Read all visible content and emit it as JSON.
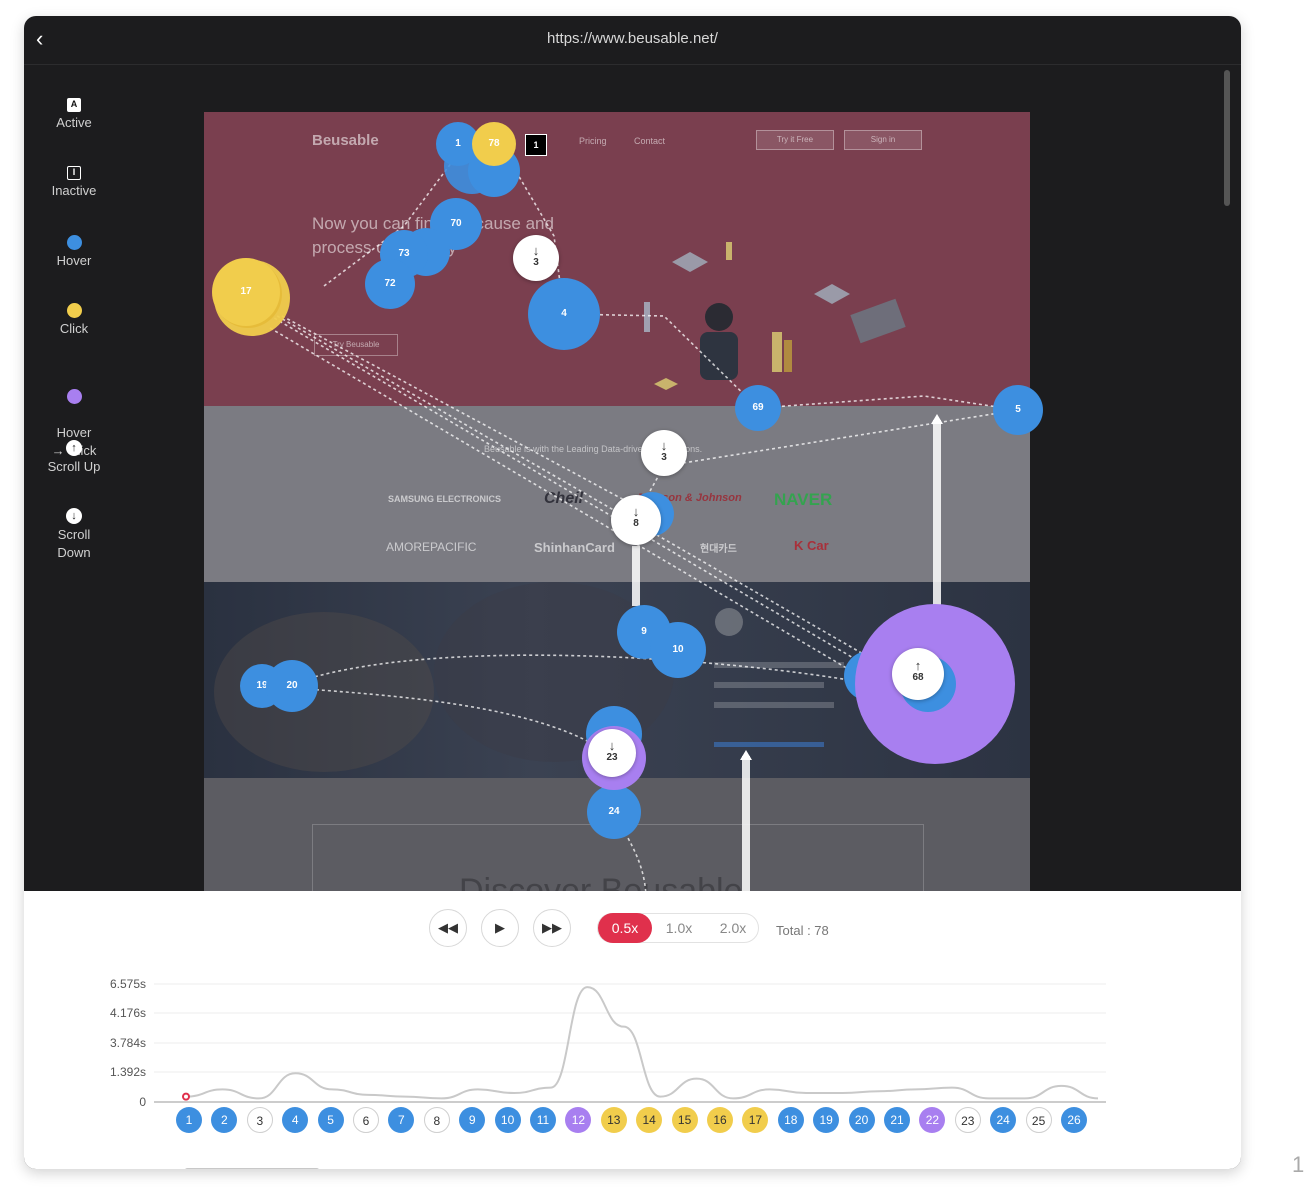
{
  "window": {
    "url": "https://www.beusable.net/"
  },
  "legend": [
    {
      "label": "Active",
      "icon": "active-square-icon"
    },
    {
      "label": "Inactive",
      "icon": "inactive-square-icon"
    },
    {
      "label": "Hover",
      "icon": "hover-dot-icon",
      "color": "#3d8fe0"
    },
    {
      "label": "Click",
      "icon": "click-dot-icon",
      "color": "#f1cd4c"
    },
    {
      "label": "Hover\n→ Click",
      "icon": "hover-click-dot-icon",
      "color": "#a87ff0"
    },
    {
      "label": "Scroll Up",
      "icon": "scroll-up-icon"
    },
    {
      "label": "Scroll Down",
      "icon": "scroll-down-icon"
    }
  ],
  "site": {
    "brand": "Beusable",
    "nav": [
      "Pricing",
      "Contact"
    ],
    "buttons": [
      "Try it Free",
      "Sign in"
    ],
    "headline": "Now you can find the cause and process of usability",
    "cta": "Try Beusable",
    "partners_heading": "Beusable is with the Leading Data-driven corporations.",
    "partner_logos": [
      "SAMSUNG ELECTRONICS",
      "Cheil",
      "Johnson & Johnson",
      "NAVER",
      "AMOREPACIFIC",
      "ShinhanCard",
      "현대카드",
      "K Car"
    ],
    "bottom_heading": "Discover Beusable"
  },
  "markers": {
    "hover": [
      "1",
      "70",
      "73",
      "72",
      "4",
      "69",
      "5",
      "9",
      "10",
      "19",
      "20",
      "24"
    ],
    "click": [
      "78",
      "17"
    ],
    "hover_click": [
      "68"
    ],
    "scroll": [
      {
        "label": "3",
        "dir": "down"
      },
      {
        "label": "3",
        "dir": "down"
      },
      {
        "label": "8",
        "dir": "down"
      },
      {
        "label": "68",
        "dir": "up"
      },
      {
        "label": "23",
        "dir": "down"
      }
    ],
    "active": "1"
  },
  "controls": {
    "rewind": "rewind-icon",
    "play": "play-icon",
    "forward": "fast-forward-icon",
    "speeds": [
      "0.5x",
      "1.0x",
      "2.0x"
    ],
    "selected_speed": "0.5x",
    "total": "Total : 78"
  },
  "chart_data": {
    "type": "line",
    "ylabels": [
      "6.575s",
      "4.176s",
      "3.784s",
      "1.392s",
      "0"
    ],
    "x": [
      "1",
      "2",
      "3",
      "4",
      "5",
      "6",
      "7",
      "8",
      "9",
      "10",
      "11",
      "12",
      "13",
      "14",
      "15",
      "16",
      "17",
      "18",
      "19",
      "20",
      "21",
      "22",
      "23",
      "24",
      "25",
      "26"
    ],
    "y": [
      0.3,
      0.7,
      0.2,
      1.6,
      0.7,
      0.4,
      0.3,
      0.2,
      0.7,
      0.5,
      0.8,
      6.4,
      4.2,
      0.3,
      1.3,
      0.2,
      0.7,
      0.5,
      0.5,
      0.6,
      0.7,
      0.8,
      0.2,
      0.2,
      0.9,
      0.2
    ]
  },
  "sequence": [
    {
      "n": "1",
      "t": "hover"
    },
    {
      "n": "2",
      "t": "hover"
    },
    {
      "n": "3",
      "t": "scroll"
    },
    {
      "n": "4",
      "t": "hover"
    },
    {
      "n": "5",
      "t": "hover"
    },
    {
      "n": "6",
      "t": "scroll"
    },
    {
      "n": "7",
      "t": "hover"
    },
    {
      "n": "8",
      "t": "scroll"
    },
    {
      "n": "9",
      "t": "hover"
    },
    {
      "n": "10",
      "t": "hover"
    },
    {
      "n": "11",
      "t": "hover"
    },
    {
      "n": "12",
      "t": "hoverclick"
    },
    {
      "n": "13",
      "t": "click"
    },
    {
      "n": "14",
      "t": "click"
    },
    {
      "n": "15",
      "t": "click"
    },
    {
      "n": "16",
      "t": "click"
    },
    {
      "n": "17",
      "t": "click"
    },
    {
      "n": "18",
      "t": "hover"
    },
    {
      "n": "19",
      "t": "hover"
    },
    {
      "n": "20",
      "t": "hover"
    },
    {
      "n": "21",
      "t": "hover"
    },
    {
      "n": "22",
      "t": "hoverclick"
    },
    {
      "n": "23",
      "t": "scroll"
    },
    {
      "n": "24",
      "t": "hover"
    },
    {
      "n": "25",
      "t": "scroll"
    },
    {
      "n": "26",
      "t": "hover"
    }
  ],
  "page_number": "1"
}
